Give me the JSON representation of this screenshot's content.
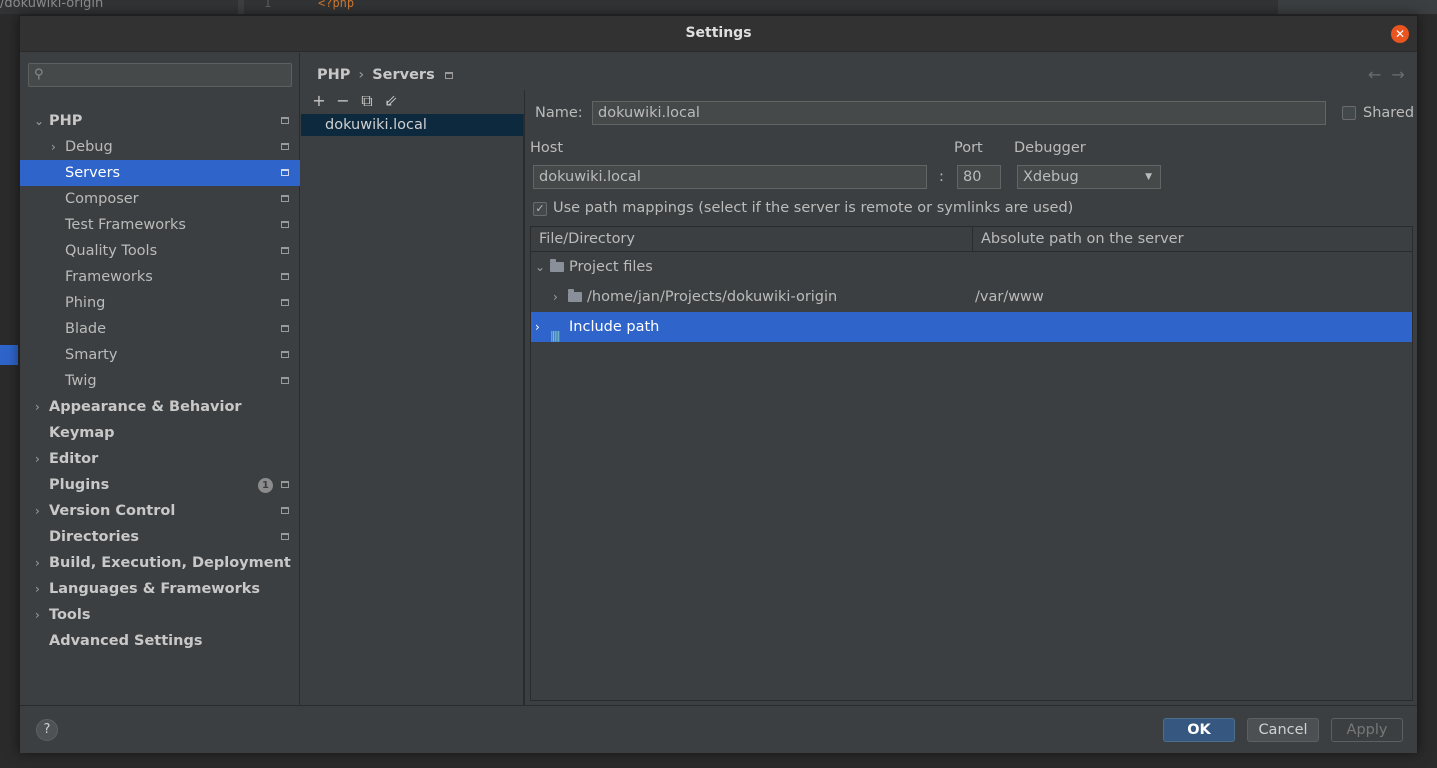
{
  "background": {
    "project_name": "/dokuwiki-origin",
    "line_number": "1",
    "code_snippet": "<?php"
  },
  "dialog": {
    "title": "Settings"
  },
  "nav": {
    "search_placeholder": "",
    "items": [
      {
        "label": "PHP",
        "level": 0,
        "expanded": true,
        "bold": true,
        "project_icon": true
      },
      {
        "label": "Debug",
        "level": 1,
        "collapsed": true,
        "project_icon": true
      },
      {
        "label": "Servers",
        "level": 1,
        "selected": true,
        "project_icon": true
      },
      {
        "label": "Composer",
        "level": 1,
        "project_icon": true
      },
      {
        "label": "Test Frameworks",
        "level": 1,
        "project_icon": true
      },
      {
        "label": "Quality Tools",
        "level": 1,
        "project_icon": true
      },
      {
        "label": "Frameworks",
        "level": 1,
        "project_icon": true
      },
      {
        "label": "Phing",
        "level": 1,
        "project_icon": true
      },
      {
        "label": "Blade",
        "level": 1,
        "project_icon": true
      },
      {
        "label": "Smarty",
        "level": 1,
        "project_icon": true
      },
      {
        "label": "Twig",
        "level": 1,
        "project_icon": true
      },
      {
        "label": "Appearance & Behavior",
        "level": 0,
        "collapsed": true,
        "bold": true
      },
      {
        "label": "Keymap",
        "level": 0,
        "bold": true
      },
      {
        "label": "Editor",
        "level": 0,
        "collapsed": true,
        "bold": true
      },
      {
        "label": "Plugins",
        "level": 0,
        "bold": true,
        "badge": "1",
        "project_icon": true
      },
      {
        "label": "Version Control",
        "level": 0,
        "collapsed": true,
        "bold": true,
        "project_icon": true
      },
      {
        "label": "Directories",
        "level": 0,
        "bold": true,
        "project_icon": true
      },
      {
        "label": "Build, Execution, Deployment",
        "level": 0,
        "collapsed": true,
        "bold": true
      },
      {
        "label": "Languages & Frameworks",
        "level": 0,
        "collapsed": true,
        "bold": true
      },
      {
        "label": "Tools",
        "level": 0,
        "collapsed": true,
        "bold": true
      },
      {
        "label": "Advanced Settings",
        "level": 0,
        "bold": true
      }
    ]
  },
  "breadcrumb": {
    "parent": "PHP",
    "separator": "›",
    "current": "Servers"
  },
  "nav_arrows": {
    "back": "←",
    "forward": "→"
  },
  "toolbar": {
    "add": "+",
    "remove": "−",
    "copy": "⧉",
    "import": "⇙"
  },
  "servers": [
    {
      "name": "dokuwiki.local"
    }
  ],
  "form": {
    "name_label": "Name:",
    "name_value": "dokuwiki.local",
    "shared_label": "Shared",
    "shared_checked": false,
    "host_label": "Host",
    "host_value": "dokuwiki.local",
    "port_separator": ":",
    "port_label": "Port",
    "port_value": "80",
    "debugger_label": "Debugger",
    "debugger_value": "Xdebug",
    "path_mappings_label": "Use path mappings (select if the server is remote or symlinks are used)",
    "path_mappings_checked": true
  },
  "mappings": {
    "columns": [
      "File/Directory",
      "Absolute path on the server"
    ],
    "rows": [
      {
        "label": "Project files",
        "expanded": true,
        "server_path": ""
      },
      {
        "label": "/home/jan/Projects/dokuwiki-origin",
        "server_path": "/var/www"
      },
      {
        "label": "Include path",
        "selected": true,
        "server_path": ""
      }
    ]
  },
  "footer": {
    "help": "?",
    "ok": "OK",
    "cancel": "Cancel",
    "apply": "Apply"
  },
  "colors": {
    "selection": "#2f65ca",
    "background": "#3c3f41",
    "ok_button": "#365880",
    "close_button": "#e95420"
  }
}
